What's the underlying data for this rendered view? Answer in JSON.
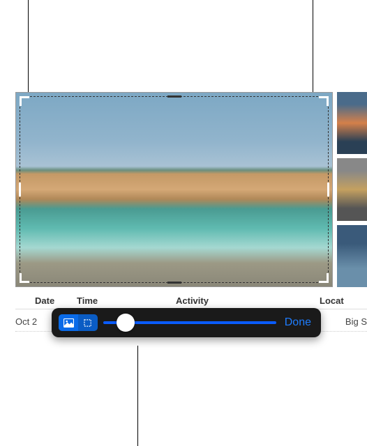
{
  "table": {
    "headers": {
      "date": "Date",
      "time": "Time",
      "activity": "Activity",
      "location": "Locat"
    },
    "row": {
      "date": "Oct 2",
      "location": "Big S"
    }
  },
  "toolbar": {
    "done": "Done"
  }
}
